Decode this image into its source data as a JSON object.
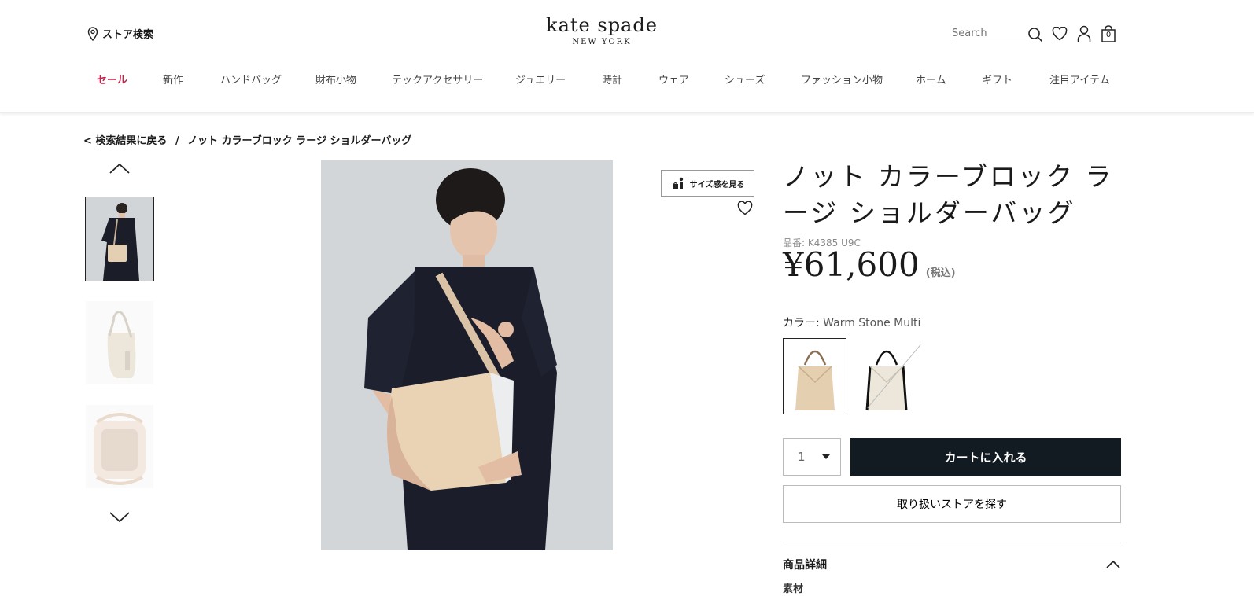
{
  "header": {
    "store_search": "ストア検索",
    "logo_line1": "kate spade",
    "logo_line2": "NEW YORK",
    "search_placeholder": "Search",
    "cart_count": "0"
  },
  "nav": {
    "items": [
      "セール",
      "新作",
      "ハンドバッグ",
      "財布小物",
      "テックアクセサリー",
      "ジュエリー",
      "時計",
      "ウェア",
      "シューズ",
      "ファッション小物",
      "ホーム",
      "ギフト",
      "注目アイテム"
    ]
  },
  "breadcrumb": {
    "back": "< 検索結果に戻る",
    "sep": "/",
    "current": "ノット カラーブロック ラージ ショルダーバッグ"
  },
  "product": {
    "size_button": "サイズ感を見る",
    "title": "ノット カラーブロック ラージ ショルダーバッグ",
    "sku": "品番: K4385 U9C",
    "price": "¥61,600",
    "tax_note": "(税込)",
    "color_label": "カラー:",
    "color_value": "Warm Stone Multi",
    "qty": "1",
    "add_to_cart": "カートに入れる",
    "find_store": "取り扱いストアを探す",
    "details_heading": "商品詳細",
    "material_label": "素材"
  },
  "colors": {
    "accent_sale": "#c4224a",
    "cart_bg": "#121a22"
  }
}
